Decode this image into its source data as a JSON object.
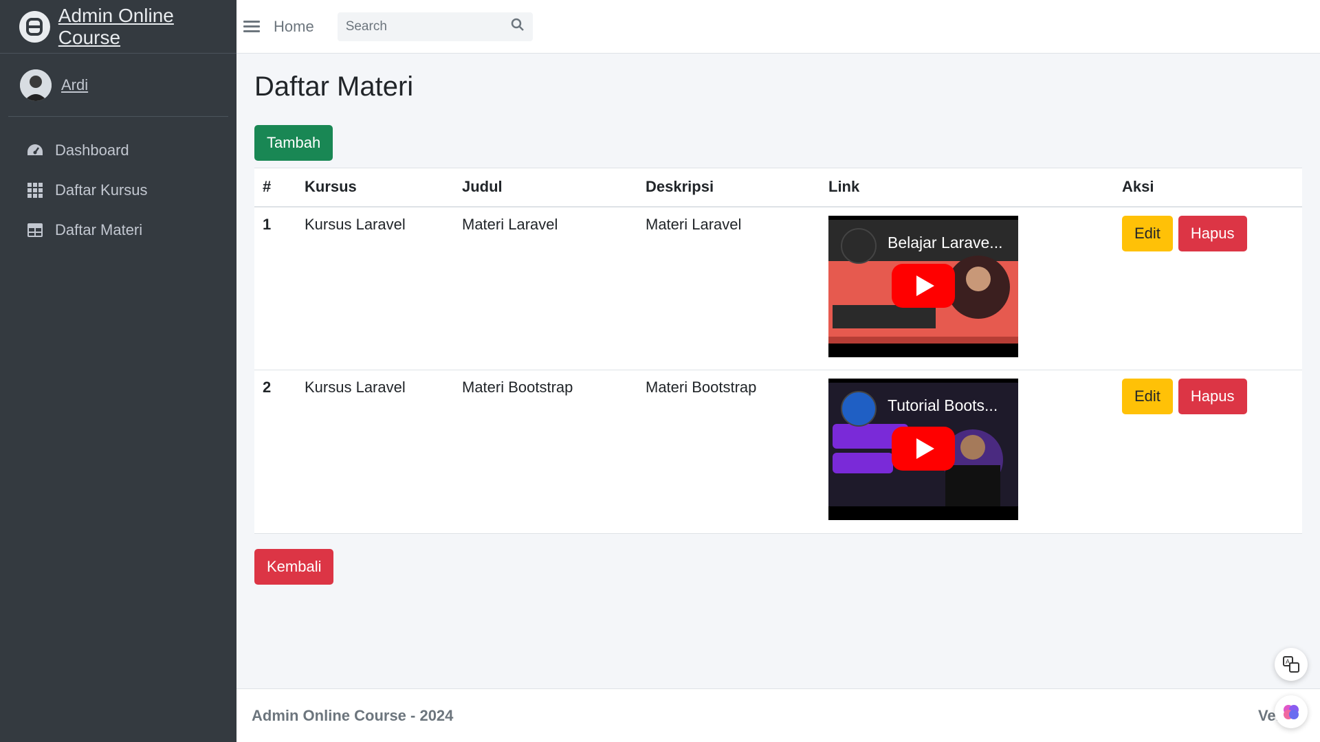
{
  "brand": {
    "title": "Admin Online Course"
  },
  "user": {
    "name": "Ardi"
  },
  "sidebar": {
    "items": [
      {
        "label": "Dashboard",
        "icon": "tachometer-icon"
      },
      {
        "label": "Daftar Kursus",
        "icon": "grid-icon"
      },
      {
        "label": "Daftar Materi",
        "icon": "table-icon"
      }
    ]
  },
  "header": {
    "home_label": "Home",
    "search_placeholder": "Search"
  },
  "page": {
    "title": "Daftar Materi",
    "add_label": "Tambah",
    "back_label": "Kembali"
  },
  "table": {
    "headers": [
      "#",
      "Kursus",
      "Judul",
      "Deskripsi",
      "Link",
      "Aksi"
    ],
    "rows": [
      {
        "num": "1",
        "kursus": "Kursus Laravel",
        "judul": "Materi Laravel",
        "deskripsi": "Materi Laravel",
        "video_title": "Belajar Larave...",
        "edit": "Edit",
        "hapus": "Hapus"
      },
      {
        "num": "2",
        "kursus": "Kursus Laravel",
        "judul": "Materi Bootstrap",
        "deskripsi": "Materi Bootstrap",
        "video_title": "Tutorial Boots...",
        "edit": "Edit",
        "hapus": "Hapus"
      }
    ]
  },
  "footer": {
    "left": "Admin Online Course - 2024",
    "right": "Versio"
  },
  "colors": {
    "sidebar": "#343a40",
    "success": "#198754",
    "danger": "#dc3545",
    "warning": "#ffc107"
  }
}
